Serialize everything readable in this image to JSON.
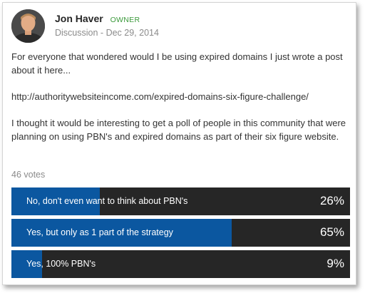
{
  "post": {
    "author": "Jon Haver",
    "role": "OWNER",
    "category": "Discussion",
    "separator": "-",
    "date": "Dec 29, 2014",
    "paragraphs": [
      "For everyone that wondered would I be using expired domains I just wrote a post about it here...",
      "http://authoritywebsiteincome.com/expired-domains-six-figure-challenge/",
      "I thought it would be interesting to get a poll of people in this community that were planning on using PBN's and expired domains as part of their six figure website."
    ]
  },
  "poll": {
    "votes_label": "46 votes",
    "options": [
      {
        "label": "No, don't even want to think about PBN's",
        "percent_text": "26%",
        "percent": 26
      },
      {
        "label": "Yes, but only as 1 part of the strategy",
        "percent_text": "65%",
        "percent": 65
      },
      {
        "label": "Yes, 100% PBN's",
        "percent_text": "9%",
        "percent": 9
      }
    ]
  },
  "colors": {
    "role": "#3b9a3b",
    "bar_fill": "#0b57a0",
    "bar_bg": "#262626"
  }
}
